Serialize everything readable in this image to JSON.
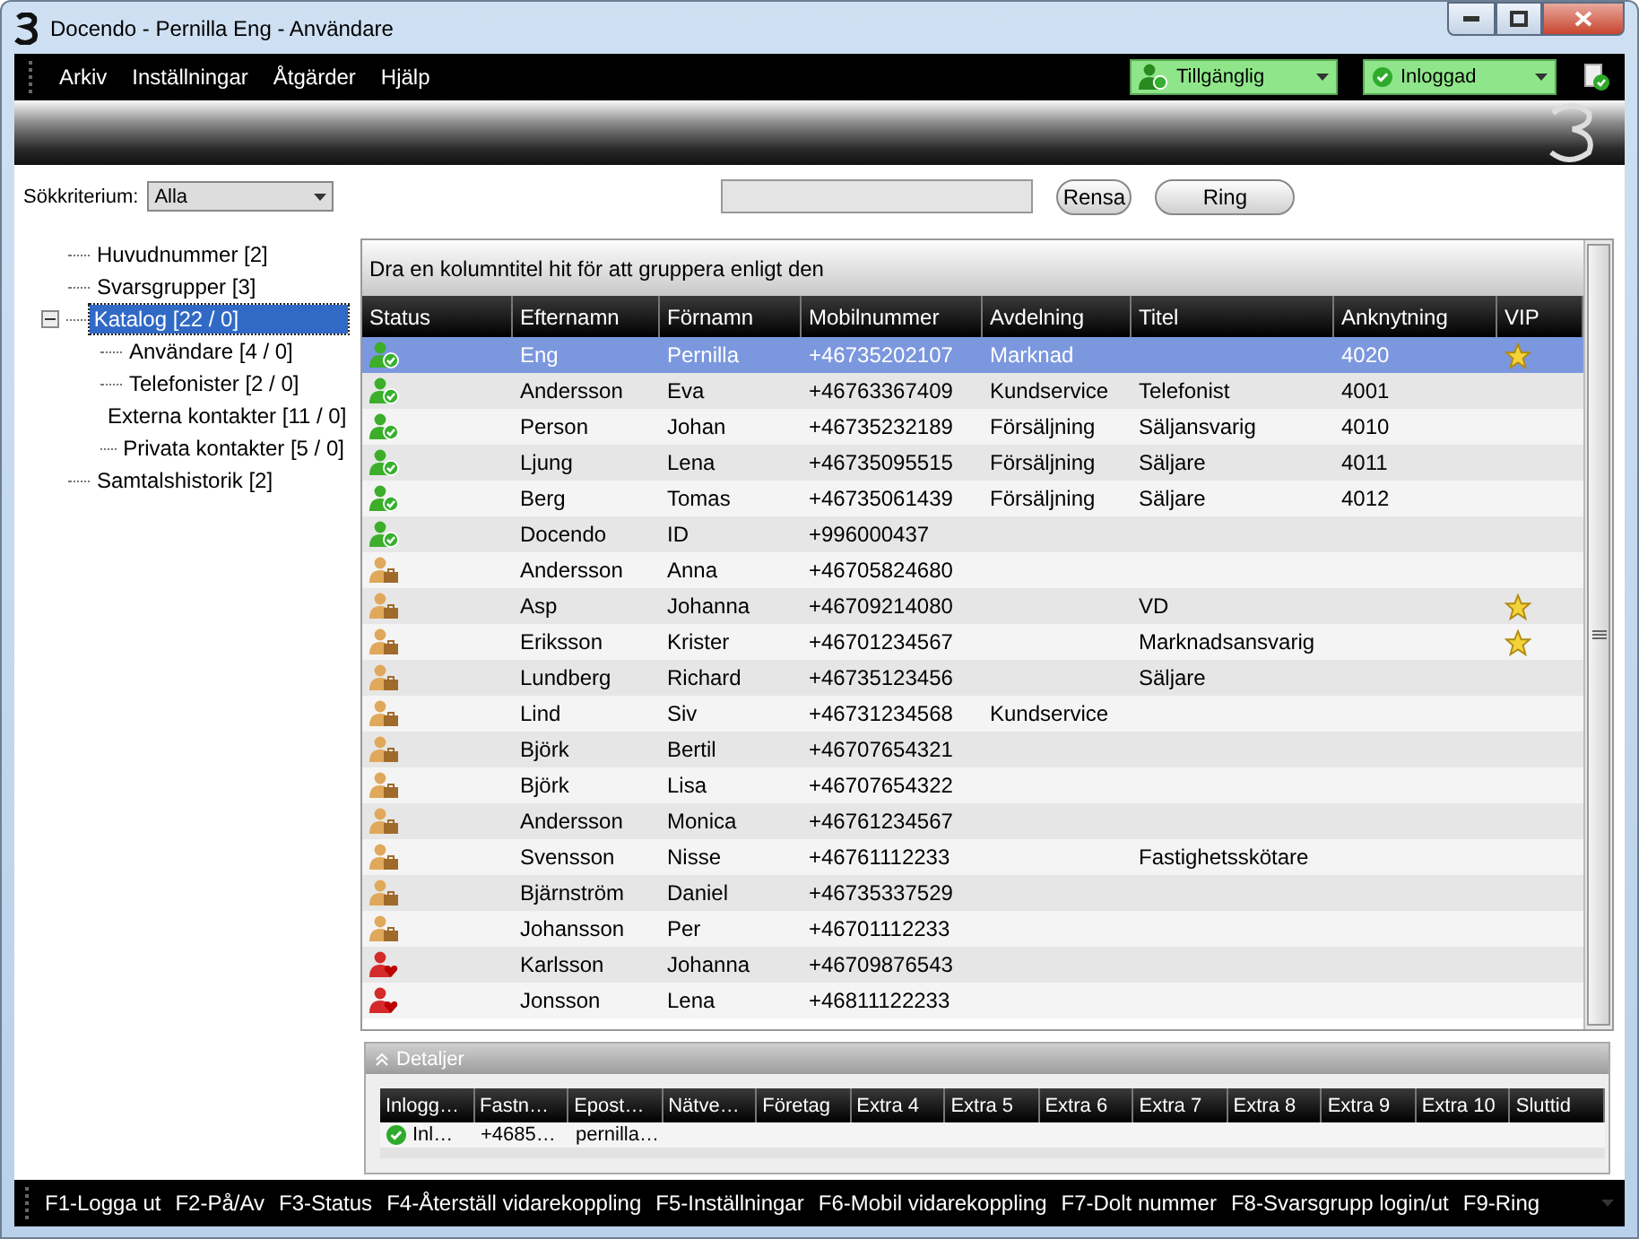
{
  "window": {
    "title": "Docendo - Pernilla Eng - Användare"
  },
  "menu": [
    "Arkiv",
    "Inställningar",
    "Åtgärder",
    "Hjälp"
  ],
  "presence": {
    "value": "Tillgänglig"
  },
  "login": {
    "value": "Inloggad"
  },
  "search": {
    "label": "Sökkriterium:",
    "criterion": "Alla"
  },
  "buttons": [
    "Rensa",
    "Ring"
  ],
  "tree": [
    {
      "label": "Huvudnummer [2]",
      "selected": false
    },
    {
      "label": "Svarsgrupper [3]",
      "selected": false
    },
    {
      "label": "Katalog [22 / 0]",
      "selected": true,
      "expanded": true,
      "children": [
        {
          "label": "Användare [4 / 0]",
          "selected": false
        },
        {
          "label": "Telefonister [2 / 0]",
          "selected": false
        },
        {
          "label": "Externa kontakter [11 / 0]",
          "selected": false
        },
        {
          "label": "Privata kontakter [5 / 0]",
          "selected": false
        }
      ]
    },
    {
      "label": "Samtalshistorik [2]",
      "selected": false
    }
  ],
  "grid": {
    "group_hint": "Dra en kolumntitel hit för att gruppera enligt den",
    "columns": [
      "Status",
      "Efternamn",
      "Förnamn",
      "Mobilnummer",
      "Avdelning",
      "Titel",
      "Anknytning",
      "VIP"
    ],
    "rows": [
      {
        "kind": "available",
        "selected": true,
        "vip": true,
        "cells": [
          "",
          "Eng",
          "Pernilla",
          "+46735202107",
          "Marknad",
          "",
          "4020"
        ]
      },
      {
        "kind": "available",
        "selected": false,
        "vip": false,
        "cells": [
          "",
          "Andersson",
          "Eva",
          "+46763367409",
          "Kundservice",
          "Telefonist",
          "4001"
        ]
      },
      {
        "kind": "available",
        "selected": false,
        "vip": false,
        "cells": [
          "",
          "Person",
          "Johan",
          "+46735232189",
          "Försäljning",
          "Säljansvarig",
          "4010"
        ]
      },
      {
        "kind": "available",
        "selected": false,
        "vip": false,
        "cells": [
          "",
          "Ljung",
          "Lena",
          "+46735095515",
          "Försäljning",
          "Säljare",
          "4011"
        ]
      },
      {
        "kind": "available",
        "selected": false,
        "vip": false,
        "cells": [
          "",
          "Berg",
          "Tomas",
          "+46735061439",
          "Försäljning",
          "Säljare",
          "4012"
        ]
      },
      {
        "kind": "available",
        "selected": false,
        "vip": false,
        "cells": [
          "",
          "Docendo",
          "ID",
          "+996000437",
          "",
          "",
          ""
        ]
      },
      {
        "kind": "work",
        "selected": false,
        "vip": false,
        "cells": [
          "",
          "Andersson",
          "Anna",
          "+46705824680",
          "",
          "",
          ""
        ]
      },
      {
        "kind": "work",
        "selected": false,
        "vip": true,
        "cells": [
          "",
          "Asp",
          "Johanna",
          "+46709214080",
          "",
          "VD",
          ""
        ]
      },
      {
        "kind": "work",
        "selected": false,
        "vip": true,
        "cells": [
          "",
          "Eriksson",
          "Krister",
          "+46701234567",
          "",
          "Marknadsansvarig",
          ""
        ]
      },
      {
        "kind": "work",
        "selected": false,
        "vip": false,
        "cells": [
          "",
          "Lundberg",
          "Richard",
          "+46735123456",
          "",
          "Säljare",
          ""
        ]
      },
      {
        "kind": "work",
        "selected": false,
        "vip": false,
        "cells": [
          "",
          "Lind",
          "Siv",
          "+46731234568",
          "Kundservice",
          "",
          ""
        ]
      },
      {
        "kind": "work",
        "selected": false,
        "vip": false,
        "cells": [
          "",
          "Björk",
          "Bertil",
          "+46707654321",
          "",
          "",
          ""
        ]
      },
      {
        "kind": "work",
        "selected": false,
        "vip": false,
        "cells": [
          "",
          "Björk",
          "Lisa",
          "+46707654322",
          "",
          "",
          ""
        ]
      },
      {
        "kind": "work",
        "selected": false,
        "vip": false,
        "cells": [
          "",
          "Andersson",
          "Monica",
          "+46761234567",
          "",
          "",
          ""
        ]
      },
      {
        "kind": "work",
        "selected": false,
        "vip": false,
        "cells": [
          "",
          "Svensson",
          "Nisse",
          "+46761112233",
          "",
          "Fastighetsskötare",
          ""
        ]
      },
      {
        "kind": "work",
        "selected": false,
        "vip": false,
        "cells": [
          "",
          "Bjärnström",
          "Daniel",
          "+46735337529",
          "",
          "",
          ""
        ]
      },
      {
        "kind": "work",
        "selected": false,
        "vip": false,
        "cells": [
          "",
          "Johansson",
          "Per",
          "+46701112233",
          "",
          "",
          ""
        ]
      },
      {
        "kind": "busy",
        "selected": false,
        "vip": false,
        "cells": [
          "",
          "Karlsson",
          "Johanna",
          "+46709876543",
          "",
          "",
          ""
        ]
      },
      {
        "kind": "busy",
        "selected": false,
        "vip": false,
        "cells": [
          "",
          "Jonsson",
          "Lena",
          "+46811122233",
          "",
          "",
          ""
        ]
      }
    ]
  },
  "details": {
    "title": "Detaljer",
    "expanded": true,
    "columns": [
      "Inlogg…",
      "Fastn…",
      "Epost…",
      "Nätve…",
      "Företag",
      "Extra 4",
      "Extra 5",
      "Extra 6",
      "Extra 7",
      "Extra 8",
      "Extra 9",
      "Extra 10",
      "Sluttid"
    ],
    "rows": [
      {
        "logged_in": true,
        "cells": [
          "Inl…",
          "+4685…",
          "pernilla…"
        ]
      }
    ]
  },
  "function_keys": [
    "F1-Logga ut",
    "F2-På/Av",
    "F3-Status",
    "F4-Återställ vidarekoppling",
    "F5-Inställningar",
    "F6-Mobil vidarekoppling",
    "F7-Dolt nummer",
    "F8-Svarsgrupp login/ut",
    "F9-Ring"
  ]
}
